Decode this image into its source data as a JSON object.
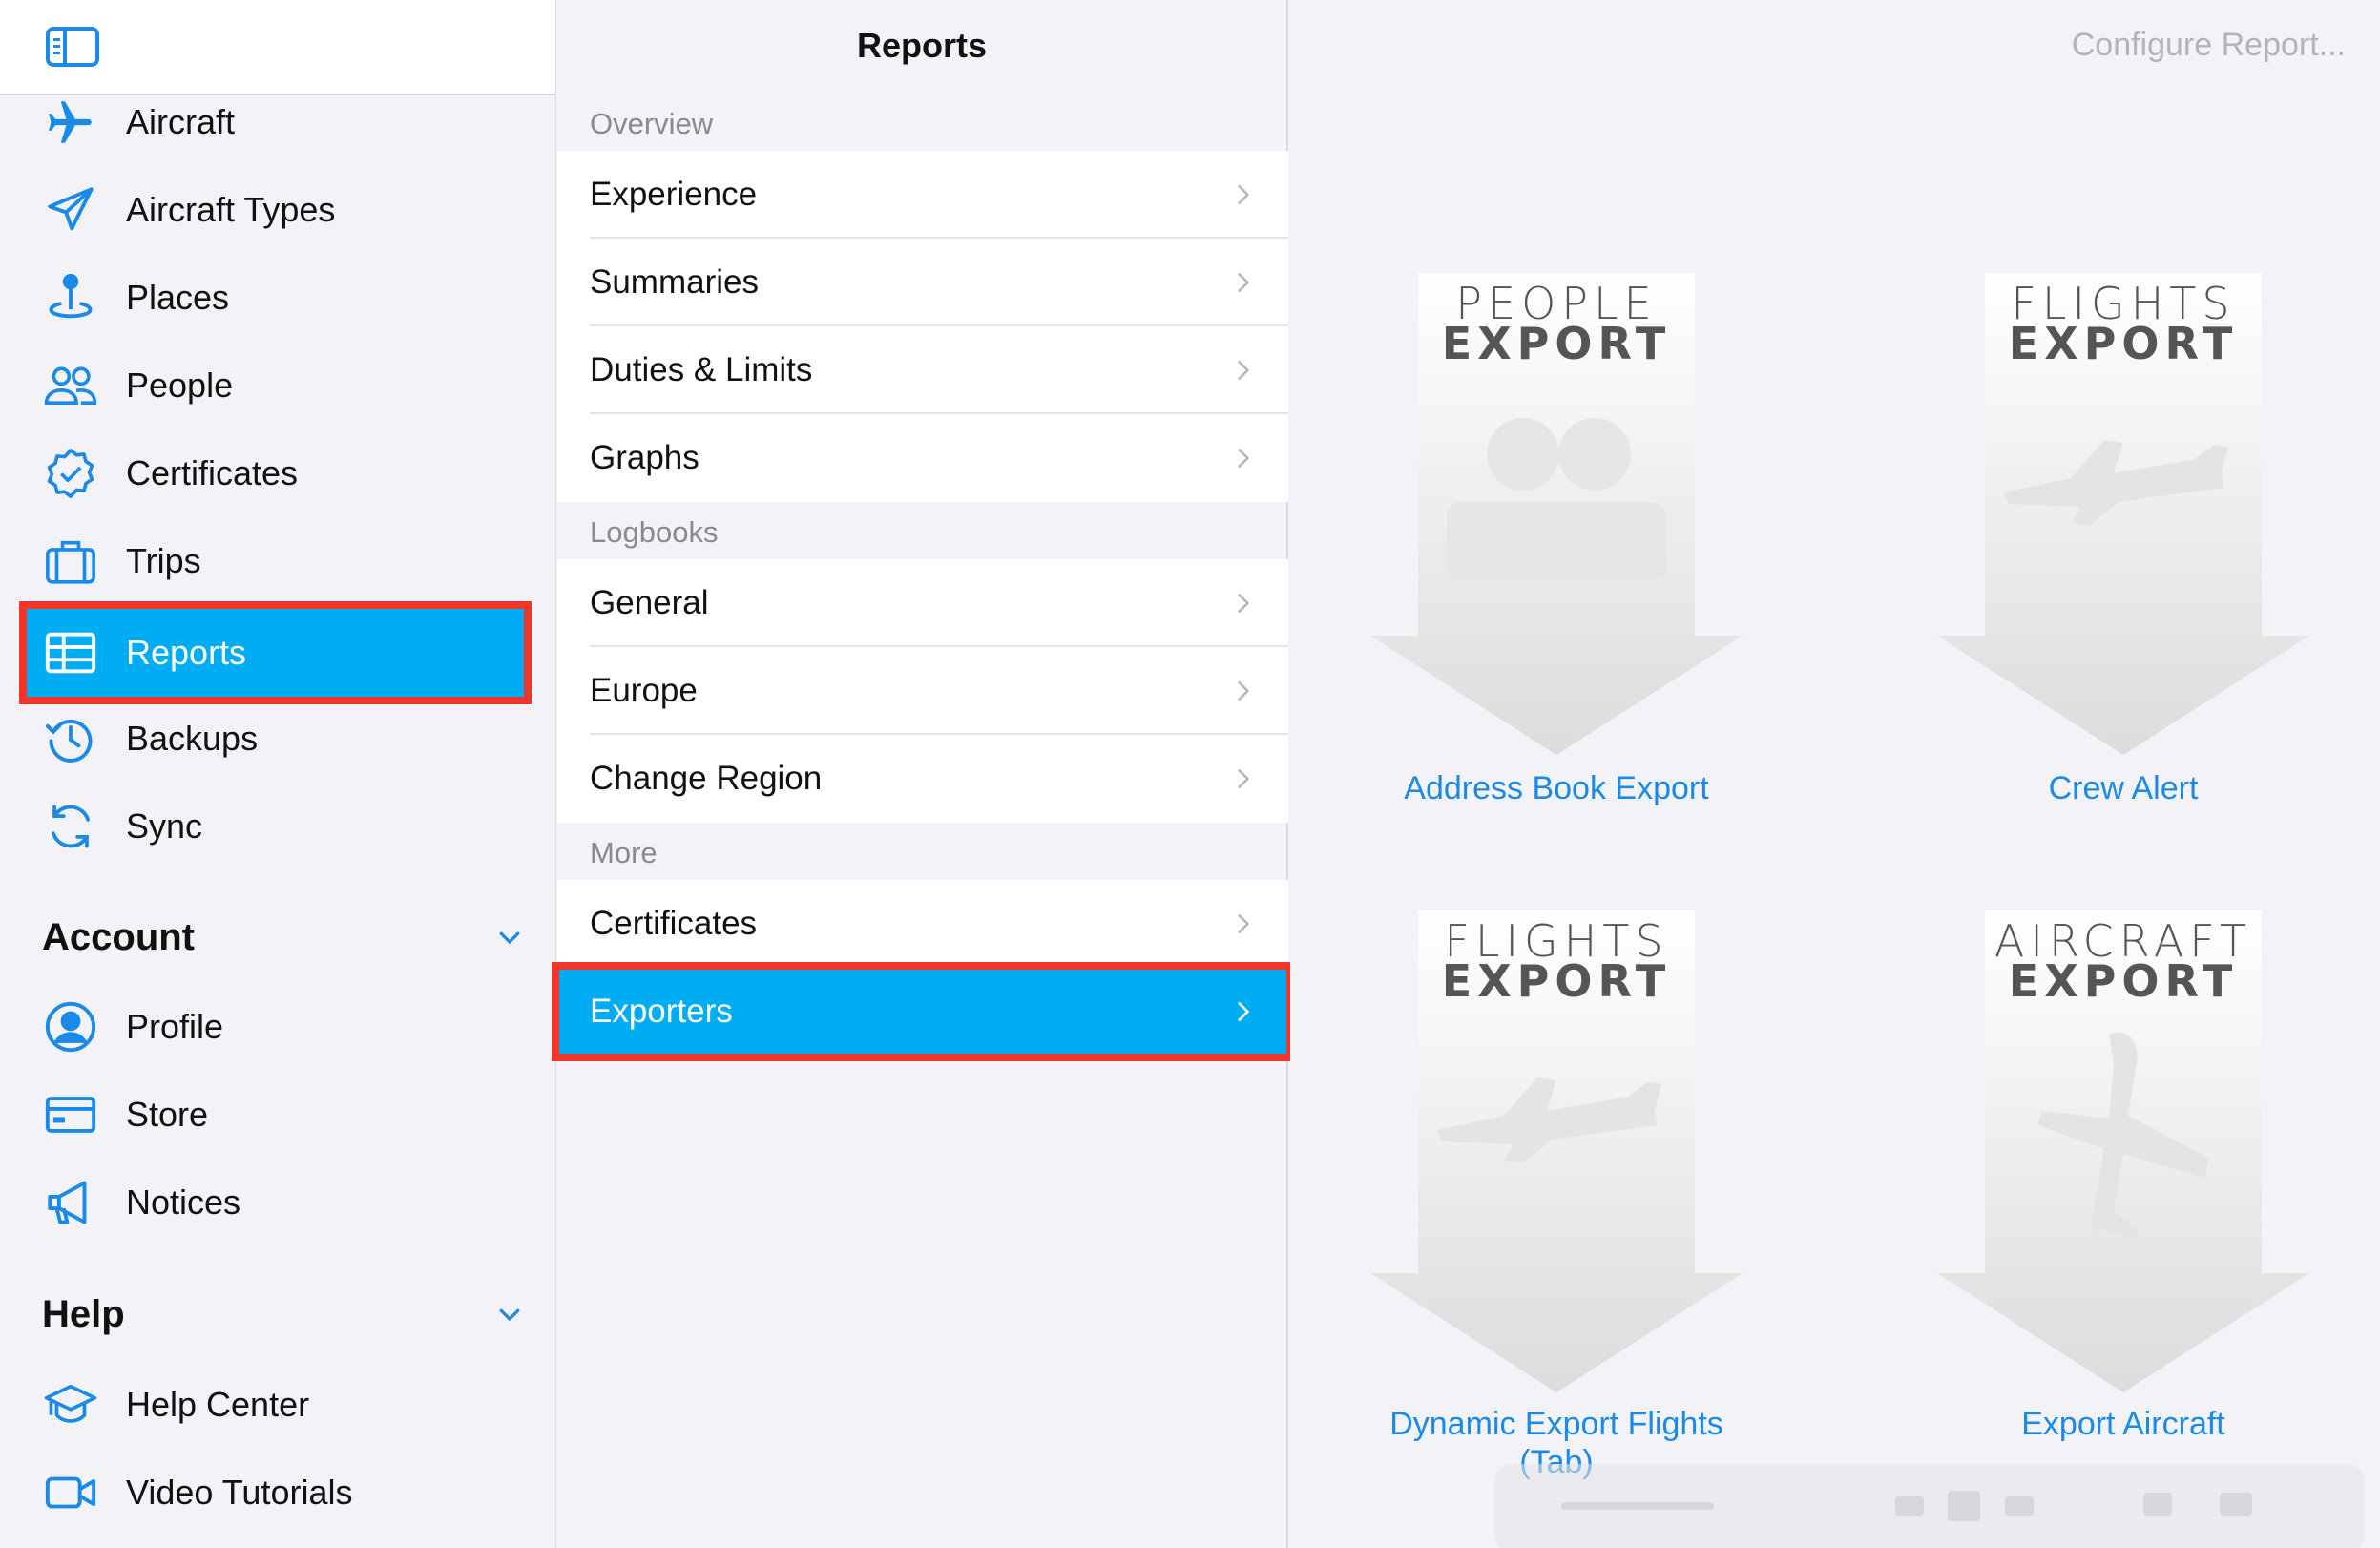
{
  "sidebar": {
    "items": [
      {
        "label": "Aircraft",
        "icon": "airplane-icon"
      },
      {
        "label": "Aircraft Types",
        "icon": "paper-plane-icon"
      },
      {
        "label": "Places",
        "icon": "map-pin-icon"
      },
      {
        "label": "People",
        "icon": "people-icon"
      },
      {
        "label": "Certificates",
        "icon": "certificate-badge-icon"
      },
      {
        "label": "Trips",
        "icon": "suitcase-icon"
      },
      {
        "label": "Reports",
        "icon": "table-icon",
        "selected": true
      },
      {
        "label": "Backups",
        "icon": "history-clock-icon"
      },
      {
        "label": "Sync",
        "icon": "sync-arrows-icon"
      }
    ],
    "account": {
      "title": "Account",
      "items": [
        {
          "label": "Profile",
          "icon": "profile-icon"
        },
        {
          "label": "Store",
          "icon": "card-icon"
        },
        {
          "label": "Notices",
          "icon": "megaphone-icon"
        }
      ]
    },
    "help": {
      "title": "Help",
      "items": [
        {
          "label": "Help Center",
          "icon": "graduation-cap-icon"
        },
        {
          "label": "Video Tutorials",
          "icon": "video-camera-icon"
        }
      ]
    }
  },
  "middle": {
    "title": "Reports",
    "groups": [
      {
        "header": "Overview",
        "rows": [
          "Experience",
          "Summaries",
          "Duties & Limits",
          "Graphs"
        ]
      },
      {
        "header": "Logbooks",
        "rows": [
          "General",
          "Europe",
          "Change Region"
        ]
      },
      {
        "header": "More",
        "rows": [
          "Certificates",
          "Exporters"
        ],
        "selected": "Exporters"
      }
    ]
  },
  "content": {
    "configure_label": "Configure Report...",
    "tiles": [
      {
        "top_word": "PEOPLE",
        "bottom_word": "EXPORT",
        "caption": "Address Book Export",
        "art": "people"
      },
      {
        "top_word": "FLIGHTS",
        "bottom_word": "EXPORT",
        "caption": "Crew Alert",
        "art": "flights"
      },
      {
        "top_word": "FLIGHTS",
        "bottom_word": "EXPORT",
        "caption": "Dynamic Export Flights (Tab)",
        "caption_l1": "Dynamic Export Flights",
        "caption_l2": "(Tab)",
        "art": "flights"
      },
      {
        "top_word": "AIRCRAFT",
        "bottom_word": "EXPORT",
        "caption": "Export Aircraft",
        "art": "aircraft"
      }
    ]
  },
  "colors": {
    "accent": "#1a8ae8",
    "selection": "#01adf2",
    "highlight_outline": "#f1352a"
  }
}
